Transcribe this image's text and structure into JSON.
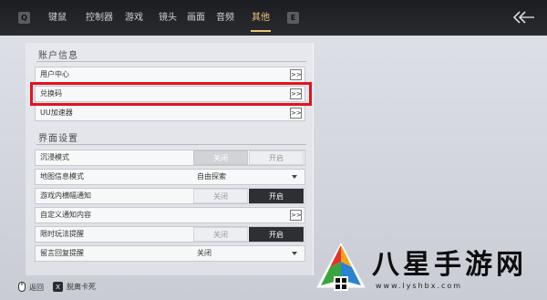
{
  "topbar": {
    "left_key": "Q",
    "right_key": "E",
    "tabs": [
      {
        "label": "键鼠",
        "active": false
      },
      {
        "label": "控制器",
        "active": false
      },
      {
        "label": "游戏",
        "active": false
      },
      {
        "label": "镜头",
        "active": false
      },
      {
        "label": "画面",
        "active": false
      },
      {
        "label": "音频",
        "active": false
      },
      {
        "label": "其他",
        "active": true
      }
    ],
    "back_icon": "double-chevron-left-icon"
  },
  "account": {
    "title": "账户信息",
    "rows": [
      {
        "label": "用户中心",
        "action": ">>"
      },
      {
        "label": "兑换码",
        "action": ">>"
      },
      {
        "label": "UU加速器",
        "action": ">>"
      }
    ]
  },
  "interface": {
    "title": "界面设置",
    "rows": [
      {
        "label": "沉浸模式",
        "off": "关闭",
        "on": "开启",
        "state": "off"
      },
      {
        "label": "地图信息模式",
        "select": "自由探索"
      },
      {
        "label": "游戏内横幅通知",
        "off": "关闭",
        "on": "开启",
        "state": "on"
      },
      {
        "label": "自定义通知内容",
        "action": ">>"
      },
      {
        "label": "限时玩法提醒",
        "off": "关闭",
        "on": "开启",
        "state": "on"
      },
      {
        "label": "留言回复提醒",
        "select": "关闭"
      }
    ]
  },
  "footer": {
    "back_label": "返回",
    "leave_key": "X",
    "leave_label": "脱离卡死"
  },
  "watermark": {
    "text": "八星手游网",
    "url": "www.lyshbx.com"
  },
  "colors": {
    "accent": "#f0c37a",
    "highlight": "#e3131f",
    "toggle_on": "#2e2f33"
  }
}
